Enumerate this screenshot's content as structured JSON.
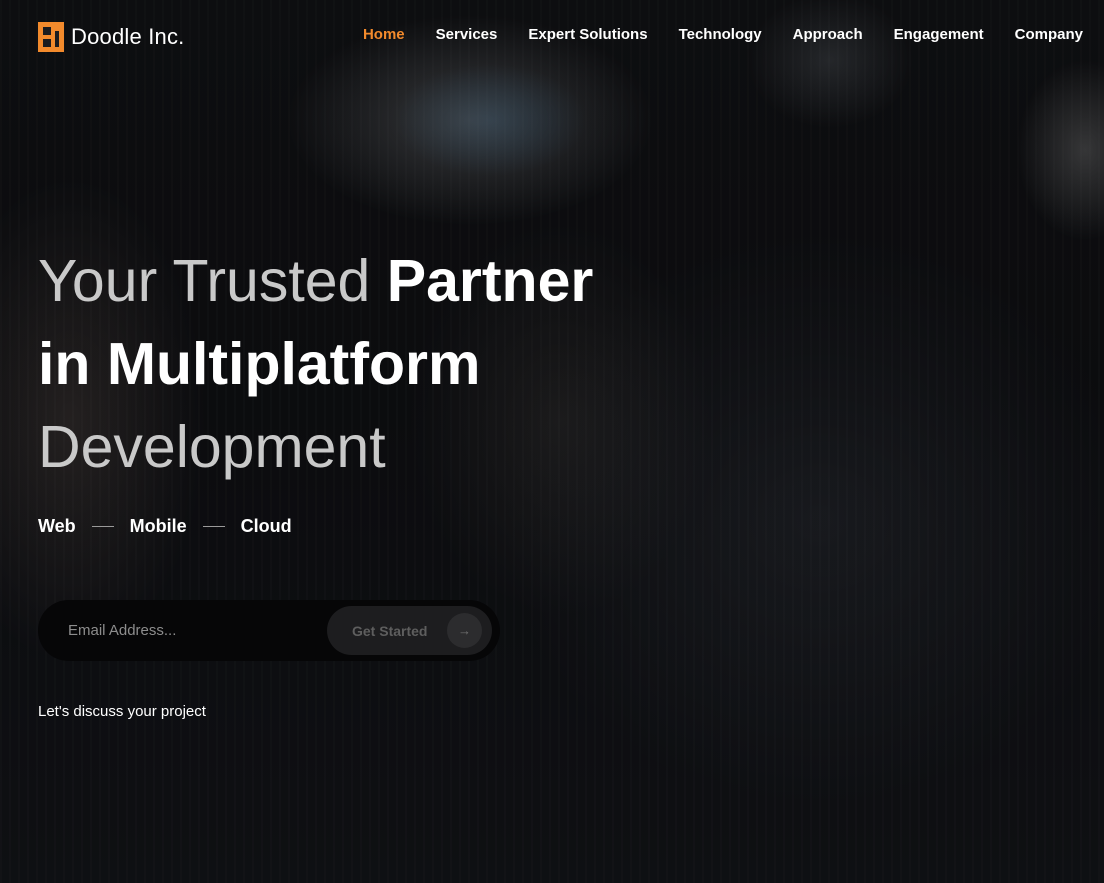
{
  "brand": {
    "name": "Doodle Inc.",
    "accent_color": "#f28a2c",
    "logo_icon": "doodle-logo-icon"
  },
  "nav": {
    "items": [
      {
        "label": "Home",
        "active": true
      },
      {
        "label": "Services",
        "active": false
      },
      {
        "label": "Expert Solutions",
        "active": false
      },
      {
        "label": "Technology",
        "active": false
      },
      {
        "label": "Approach",
        "active": false
      },
      {
        "label": "Engagement",
        "active": false
      },
      {
        "label": "Company",
        "active": false
      }
    ]
  },
  "hero": {
    "headline": {
      "line1_light": "Your Trusted ",
      "line1_bold": "Partner",
      "line2_bold": "in Multiplatform",
      "line3_light": "Development"
    },
    "platforms": [
      "Web",
      "Mobile",
      "Cloud"
    ],
    "email": {
      "placeholder": "Email Address...",
      "value": ""
    },
    "cta": {
      "label": "Get Started",
      "icon": "arrow-right-icon",
      "icon_glyph": "→"
    },
    "discuss_link": "Let's discuss your project"
  }
}
